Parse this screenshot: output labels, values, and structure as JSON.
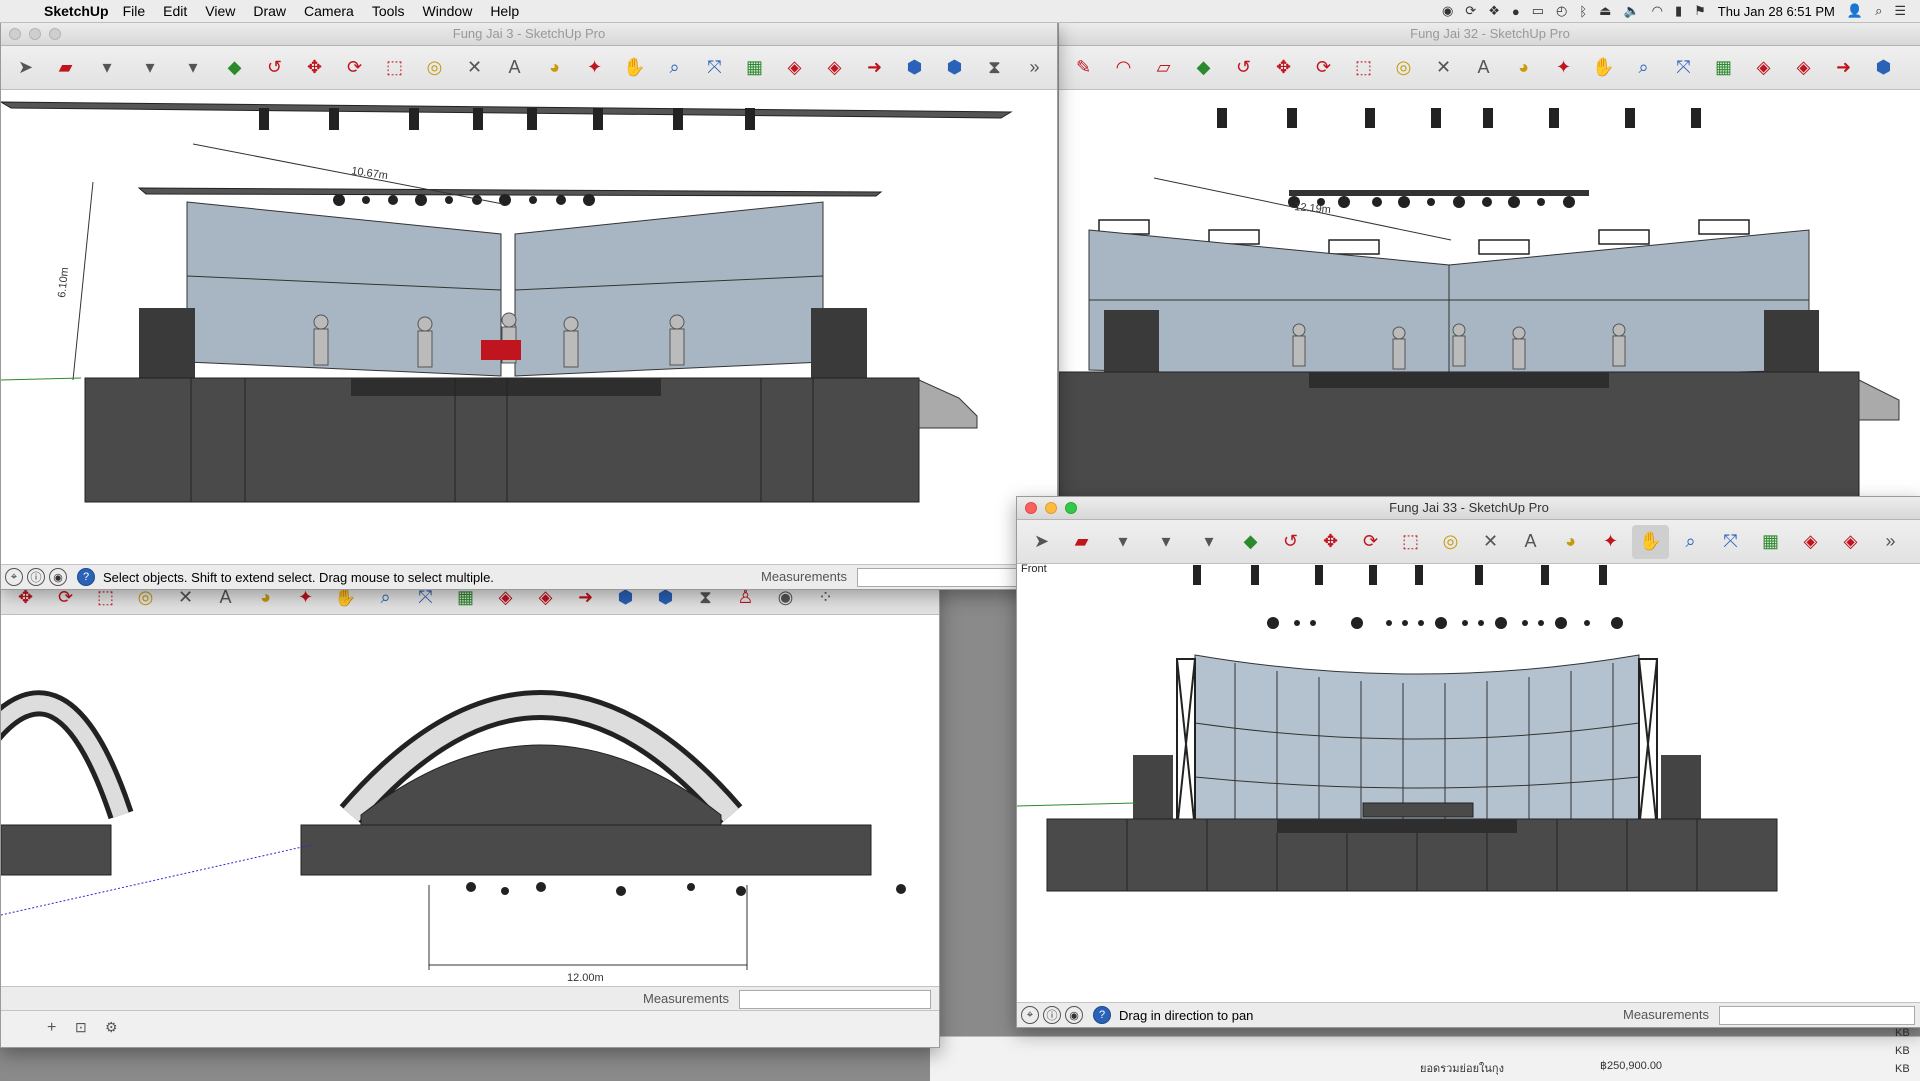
{
  "menubar": {
    "app_name": "SketchUp",
    "items": [
      "File",
      "Edit",
      "View",
      "Draw",
      "Camera",
      "Tools",
      "Window",
      "Help"
    ],
    "clock": "Thu Jan 28  6:51 PM"
  },
  "windows": {
    "w1": {
      "title": "Fung Jai 3 - SketchUp Pro",
      "dim_width": "10.67m",
      "dim_height": "6.10m",
      "status_text": "Select objects. Shift to extend select. Drag mouse to select multiple.",
      "measurements_label": "Measurements"
    },
    "w2": {
      "title": "Fung Jai 32 - SketchUp Pro",
      "dim_width": "12.19m"
    },
    "w3": {
      "title": "Fung Jai 33 - SketchUp Pro",
      "view_label": "Front",
      "status_text": "Drag in direction to pan",
      "measurements_label": "Measurements"
    },
    "w4": {
      "dim_width": "12.00m",
      "measurements_label": "Measurements"
    }
  },
  "background": {
    "footer_thai": "ยอดรวมย่อยในกุง",
    "footer_amount": "฿250,900.00",
    "kb_labels": [
      "KB",
      "KB",
      "KB"
    ]
  },
  "colors": {
    "screen": "#a7b6c2",
    "stage": "#4a4a4a",
    "truss": "#333333"
  }
}
